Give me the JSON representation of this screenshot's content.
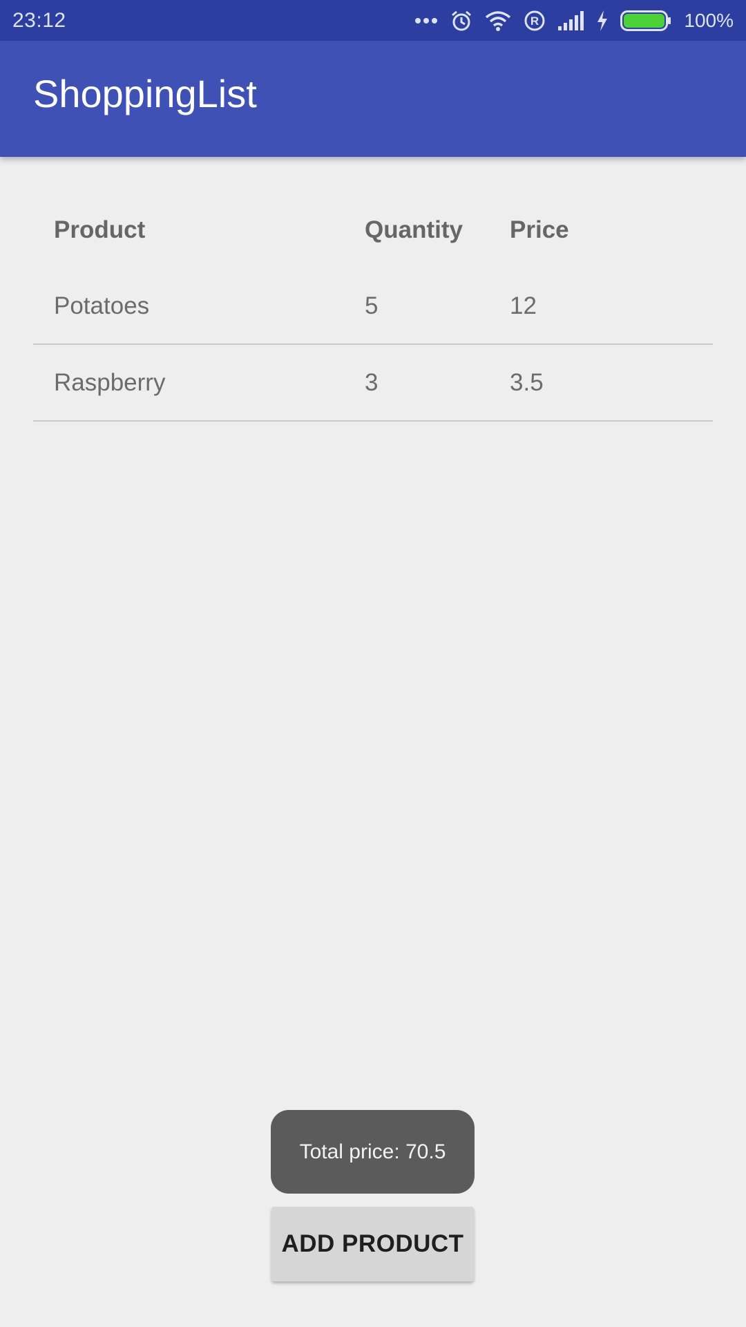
{
  "status_bar": {
    "time": "23:12",
    "battery_percent": "100%",
    "icons": [
      "more-dots-icon",
      "alarm-icon",
      "wifi-icon",
      "registered-icon",
      "signal-icon",
      "charging-icon",
      "battery-icon"
    ],
    "battery_color": "#4cd137"
  },
  "app_bar": {
    "title": "ShoppingList",
    "color": "#3f51b5"
  },
  "table": {
    "headers": {
      "product": "Product",
      "quantity": "Quantity",
      "price": "Price"
    },
    "rows": [
      {
        "product": "Potatoes",
        "quantity": "5",
        "price": "12"
      },
      {
        "product": "Raspberry",
        "quantity": "3",
        "price": "3.5"
      }
    ]
  },
  "toast": {
    "text": "Total price: 70.5"
  },
  "actions": {
    "add_product_label": "ADD PRODUCT"
  }
}
